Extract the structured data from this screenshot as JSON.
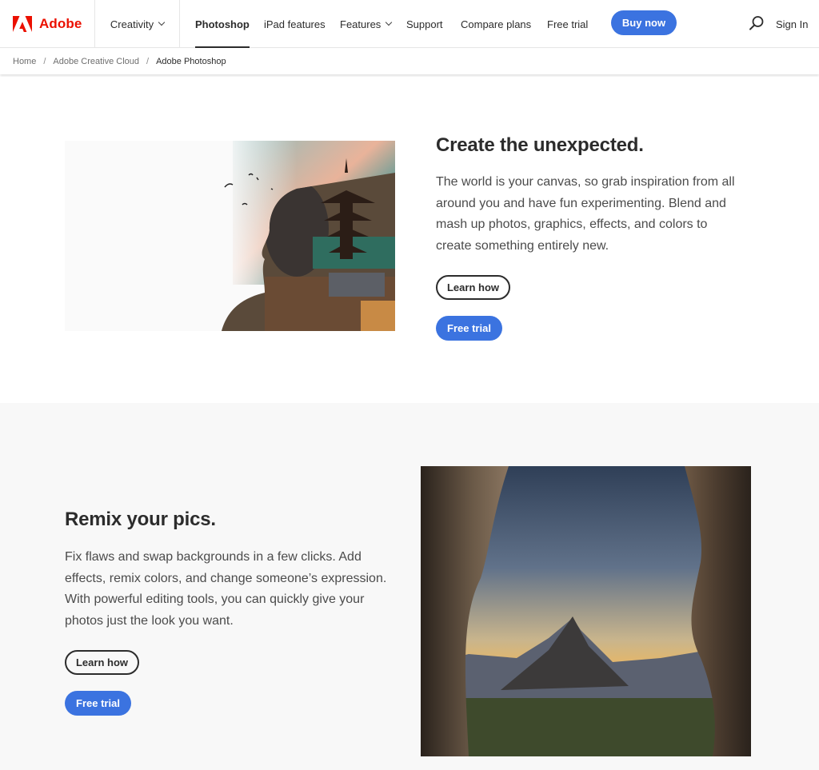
{
  "header": {
    "logo_text": "Adobe",
    "creativity_label": "Creativity",
    "nav": [
      {
        "label": "Photoshop",
        "active": true
      },
      {
        "label": "iPad features"
      },
      {
        "label": "Features",
        "dropdown": true
      },
      {
        "label": "Support"
      },
      {
        "label": "Compare plans"
      },
      {
        "label": "Free trial"
      }
    ],
    "buy_now_label": "Buy now",
    "search_icon": "search-icon",
    "sign_in_label": "Sign In",
    "brand_color": "#eb1000",
    "accent_color": "#3b73e0"
  },
  "breadcrumb": {
    "items": [
      "Home",
      "Adobe Creative Cloud",
      "Adobe Photoshop"
    ],
    "separator": "/"
  },
  "sections": [
    {
      "title": "Create the unexpected.",
      "body": "The world is your canvas, so grab inspiration from all around you and have fun experimenting. Blend and mash up photos, graphics, effects, and colors to create something entirely new.",
      "learn_label": "Learn how",
      "trial_label": "Free trial",
      "image": "double-exposure portrait with pagoda"
    },
    {
      "title": "Remix your pics.",
      "body": "Fix flaws and swap backgrounds in a few clicks. Add effects, remix colors, and change someone’s expression. With powerful editing tools, you can quickly give your photos just the look you want.",
      "learn_label": "Learn how",
      "trial_label": "Free trial",
      "image": "mountain view through cave opening"
    }
  ]
}
